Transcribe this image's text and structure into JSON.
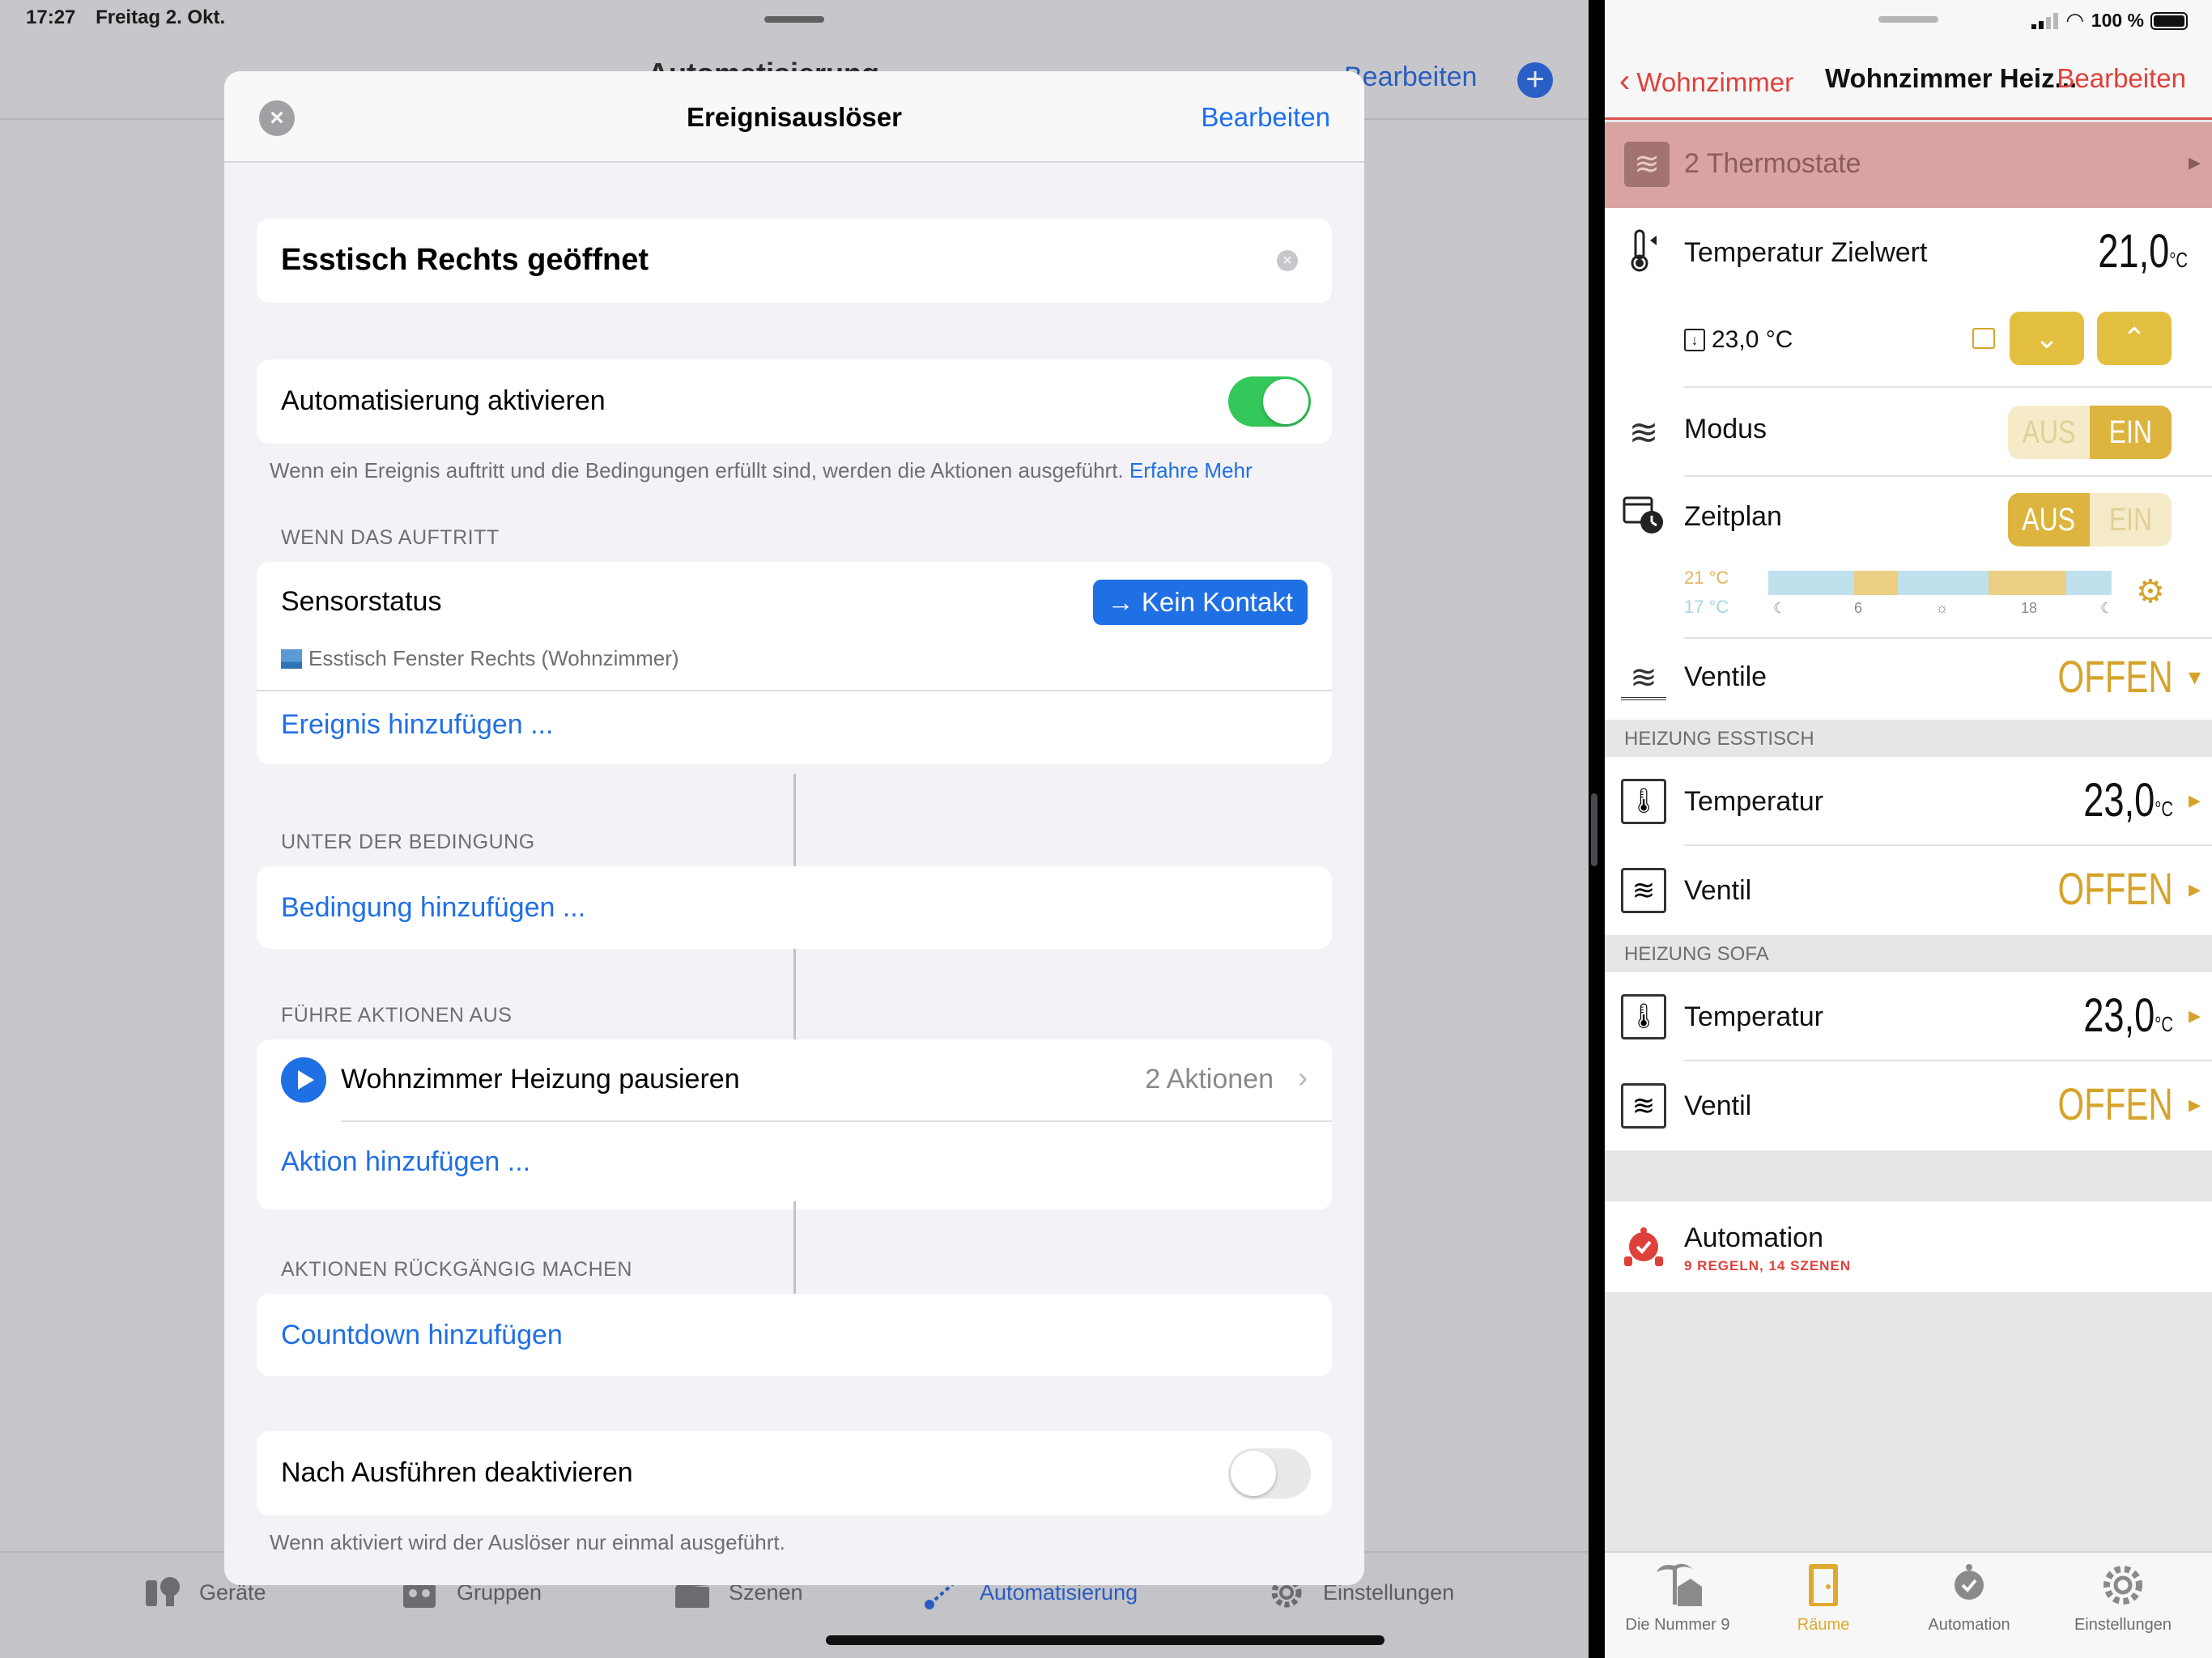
{
  "status_left": {
    "time": "17:27",
    "date": "Freitag 2. Okt."
  },
  "left_app": {
    "nav_title": "Automatisierung",
    "nav_edit": "Bearbeiten",
    "nav_add": "+",
    "tabs": [
      {
        "label": "Geräte",
        "icon": "bulb-plug-icon"
      },
      {
        "label": "Gruppen",
        "icon": "groups-icon"
      },
      {
        "label": "Szenen",
        "icon": "clapper-icon"
      },
      {
        "label": "Automatisierung",
        "icon": "automation-icon",
        "active": true
      },
      {
        "label": "Einstellungen",
        "icon": "gear-icon"
      }
    ]
  },
  "modal": {
    "title": "Ereignisauslöser",
    "edit": "Bearbeiten",
    "name_value": "Esstisch Rechts geöffnet",
    "enable_label": "Automatisierung aktivieren",
    "enable_on": true,
    "enable_note": "Wenn ein Ereignis auftritt und die Bedingungen erfüllt sind, werden die Aktionen ausgeführt.",
    "learn_more": "Erfahre Mehr",
    "when_header": "WENN DAS AUFTRITT",
    "sensor_label": "Sensorstatus",
    "sensor_state": "→ Kein Kontakt",
    "sensor_device": "Esstisch Fenster Rechts (Wohnzimmer)",
    "add_event": "Ereignis hinzufügen ...",
    "condition_header": "UNTER DER BEDINGUNG",
    "add_condition": "Bedingung hinzufügen ...",
    "actions_header": "FÜHRE AKTIONEN AUS",
    "scene_label": "Wohnzimmer Heizung pausieren",
    "scene_count": "2 Aktionen",
    "add_action": "Aktion hinzufügen ...",
    "undo_header": "AKTIONEN RÜCKGÄNGIG MACHEN",
    "add_countdown": "Countdown hinzufügen",
    "deactivate_label": "Nach Ausführen deaktivieren",
    "deactivate_on": false,
    "deactivate_note": "Wenn aktiviert wird der Auslöser nur einmal ausgeführt."
  },
  "right_app": {
    "status": {
      "battery": "100 %"
    },
    "back_label": "Wohnzimmer",
    "title": "Wohnzimmer Heiz...",
    "edit": "Bearbeiten",
    "group_row": "2 Thermostate",
    "target_label": "Temperatur Zielwert",
    "target_value": "21,0",
    "unit": "°C",
    "current_temp": "23,0 °C",
    "mode_label": "Modus",
    "mode_options": [
      "AUS",
      "EIN"
    ],
    "mode_selected": "EIN",
    "schedule_label": "Zeitplan",
    "schedule_options": [
      "AUS",
      "EIN"
    ],
    "schedule_selected": "AUS",
    "schedule_high": "21 °C",
    "schedule_low": "17 °C",
    "schedule_ticks": [
      "6",
      "18"
    ],
    "valves_label": "Ventile",
    "valves_value": "OFFEN",
    "section_esstisch": "HEIZUNG ESSTISCH",
    "esstisch_temp_label": "Temperatur",
    "esstisch_temp_value": "23,0",
    "esstisch_valve_label": "Ventil",
    "esstisch_valve_value": "OFFEN",
    "section_sofa": "HEIZUNG SOFA",
    "sofa_temp_label": "Temperatur",
    "sofa_temp_value": "23,0",
    "sofa_valve_label": "Ventil",
    "sofa_valve_value": "OFFEN",
    "automation_label": "Automation",
    "automation_sub": "9 REGELN, 14 SZENEN",
    "tabs": [
      {
        "label": "Die Nummer 9",
        "icon": "house-palm-icon"
      },
      {
        "label": "Räume",
        "icon": "door-icon",
        "active": true
      },
      {
        "label": "Automation",
        "icon": "automation-robot-icon"
      },
      {
        "label": "Einstellungen",
        "icon": "gear-icon"
      }
    ]
  },
  "colors": {
    "ios_blue": "#1f6fe5",
    "ios_green": "#34c759",
    "accent_red": "#e0403a",
    "accent_gold": "#d6a32a"
  }
}
